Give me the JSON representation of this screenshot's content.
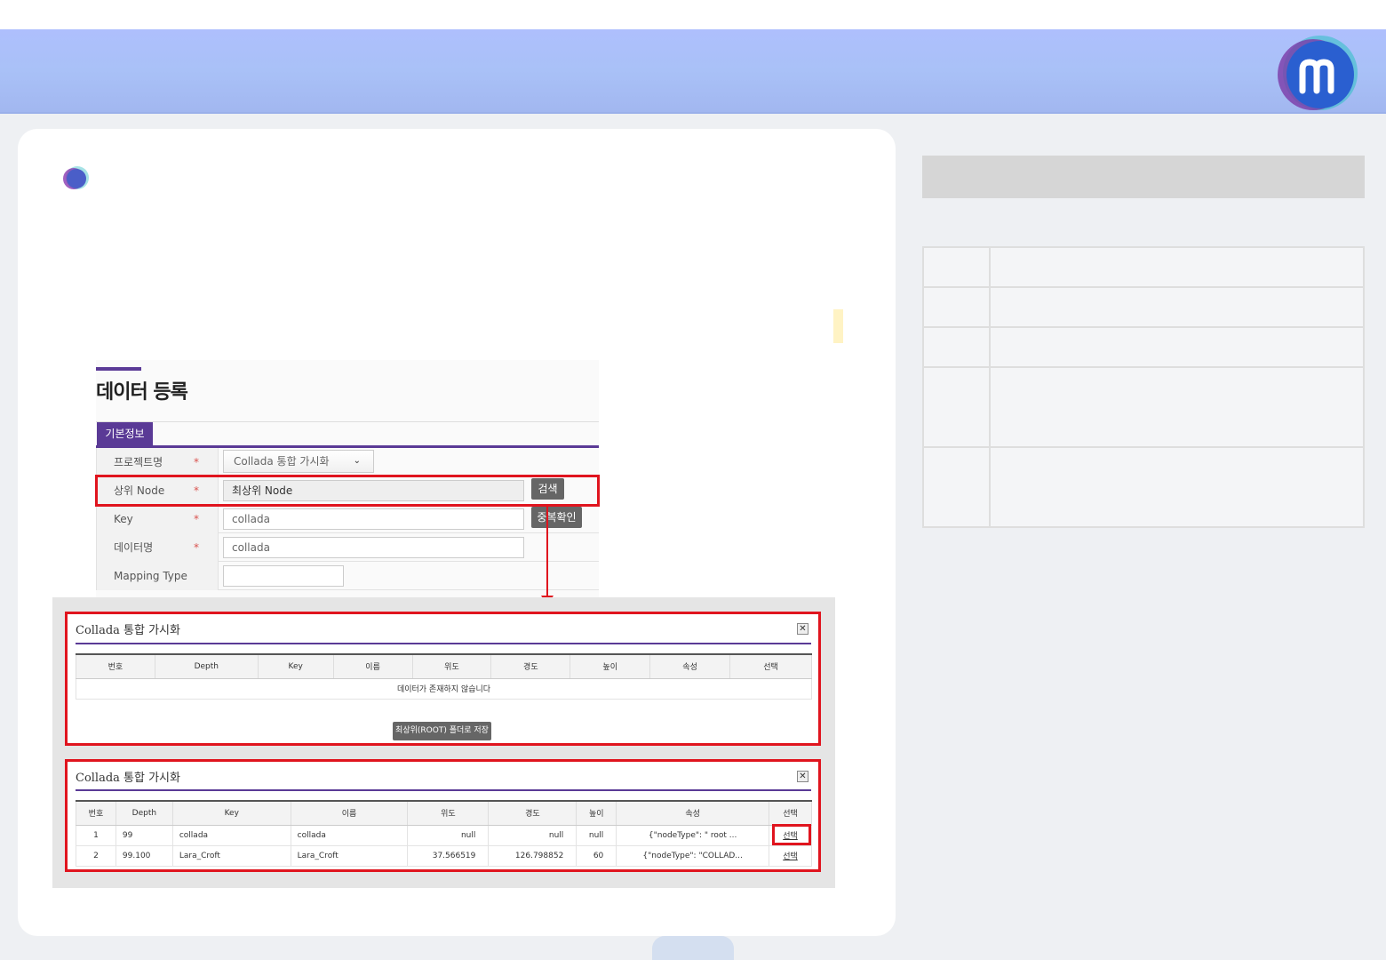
{
  "form": {
    "title": "데이터 등록",
    "tab": "기본정보",
    "required_mark": "*",
    "rows": [
      {
        "label": "프로젝트명",
        "required": true,
        "select_value": "Collada 통합 가시화"
      },
      {
        "label": "상위 Node",
        "required": true,
        "value": "최상위 Node",
        "button": "검색"
      },
      {
        "label": "Key",
        "required": true,
        "value": "collada",
        "button": "중복확인"
      },
      {
        "label": "데이터명",
        "required": true,
        "value": "collada"
      },
      {
        "label": "Mapping Type",
        "required": false,
        "value": ""
      }
    ]
  },
  "popup_empty": {
    "title": "Collada 통합 가시화",
    "close_glyph": "✕",
    "columns": [
      "번호",
      "Depth",
      "Key",
      "이름",
      "위도",
      "경도",
      "높이",
      "속성",
      "선택"
    ],
    "empty_message": "데이터가 존재하지 않습니다",
    "root_button": "최상위(ROOT) 폴더로 저장"
  },
  "popup_data": {
    "title": "Collada 통합 가시화",
    "close_glyph": "✕",
    "columns": [
      "번호",
      "Depth",
      "Key",
      "이름",
      "위도",
      "경도",
      "높이",
      "속성",
      "선택"
    ],
    "rows": [
      {
        "no": "1",
        "depth": "99",
        "key": "collada",
        "name": "collada",
        "lat": "null",
        "lon": "null",
        "height": "null",
        "attr": "{\"nodeType\": \" root ...",
        "select": "선택"
      },
      {
        "no": "2",
        "depth": "99.100",
        "key": "Lara_Croft",
        "name": "Lara_Croft",
        "lat": "37.566519",
        "lon": "126.798852",
        "height": "60",
        "attr": "{\"nodeType\": \"COLLAD...",
        "select": "선택"
      }
    ]
  },
  "colors": {
    "accent_purple": "#5a3a96",
    "highlight_red": "#e0141e",
    "header_blue": "#aebffd"
  },
  "icons": {
    "logo": "m-logo-icon",
    "bullet": "circle-bullet-icon",
    "close": "close-icon",
    "dropdown": "caret-down-icon"
  }
}
